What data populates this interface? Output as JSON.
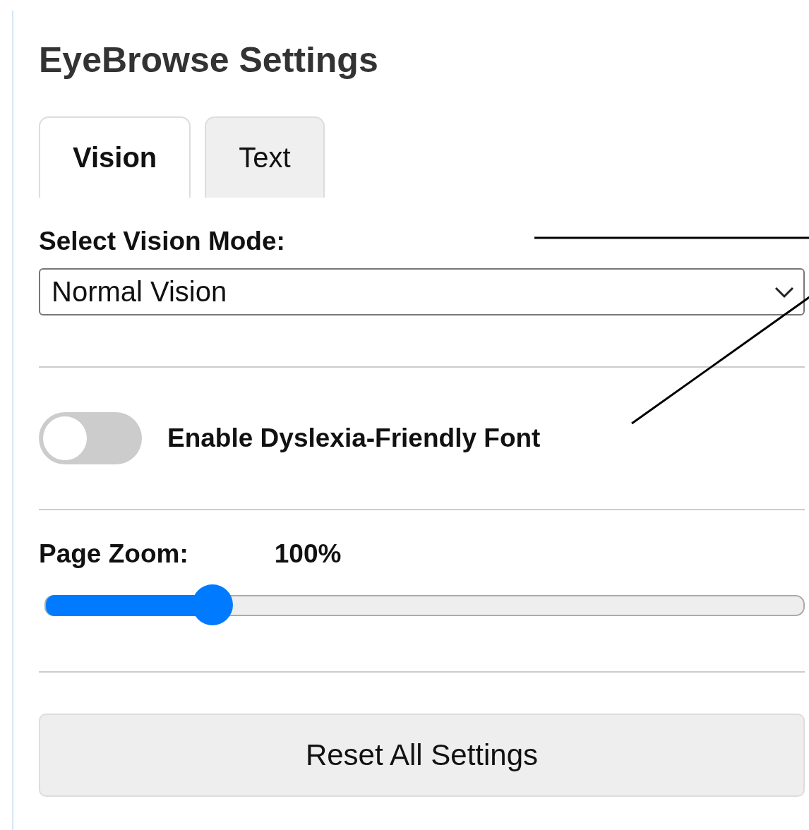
{
  "title": "EyeBrowse Settings",
  "tabs": [
    {
      "label": "Vision",
      "selected": true
    },
    {
      "label": "Text",
      "selected": false
    }
  ],
  "vision_mode": {
    "label": "Select Vision Mode:",
    "value": "Normal Vision"
  },
  "dyslexia_toggle": {
    "label": "Enable Dyslexia-Friendly Font",
    "on": false
  },
  "page_zoom": {
    "label": "Page Zoom:",
    "reading": "100%",
    "level": 0.22
  },
  "reset_button": "Reset All Settings"
}
